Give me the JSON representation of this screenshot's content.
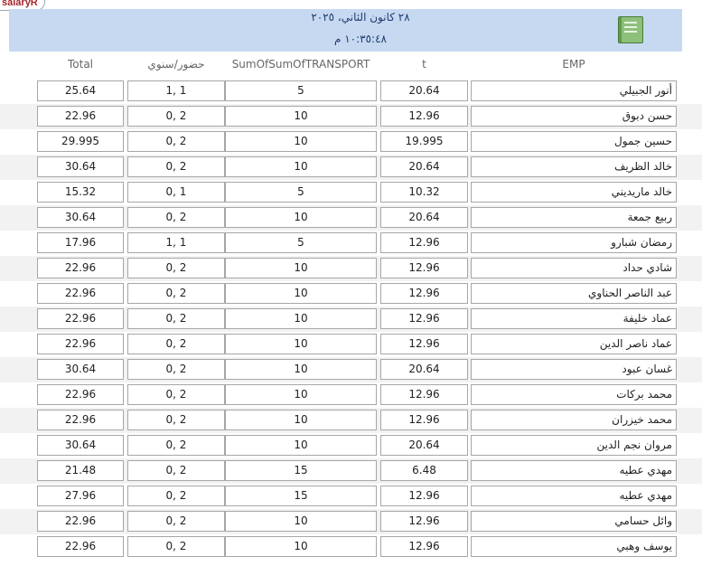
{
  "window": {
    "tab_label": "salaryR"
  },
  "header": {
    "date": "٢٨ كانون الثاني، ٢٠٢٥",
    "time": "١٠:٣٥:٤٨ م",
    "logo_icon": "report-logo-icon"
  },
  "columns": {
    "total": "Total",
    "attendance": "حضور/سنوي",
    "transport": "SumOfSumOfTRANSPORT",
    "t": "t",
    "emp": "EMP"
  },
  "rows": [
    {
      "total": "25.64",
      "attendance": "1, 1",
      "transport": "5",
      "t": "20.64",
      "emp": "أنور الجبيلي"
    },
    {
      "total": "22.96",
      "attendance": "0, 2",
      "transport": "10",
      "t": "12.96",
      "emp": "حسن دبوق"
    },
    {
      "total": "29.995",
      "attendance": "0, 2",
      "transport": "10",
      "t": "19.995",
      "emp": "حسين جمول"
    },
    {
      "total": "30.64",
      "attendance": "0, 2",
      "transport": "10",
      "t": "20.64",
      "emp": "خالد الظريف"
    },
    {
      "total": "15.32",
      "attendance": "0, 1",
      "transport": "5",
      "t": "10.32",
      "emp": "خالد ماريديني"
    },
    {
      "total": "30.64",
      "attendance": "0, 2",
      "transport": "10",
      "t": "20.64",
      "emp": "ربيع جمعة"
    },
    {
      "total": "17.96",
      "attendance": "1, 1",
      "transport": "5",
      "t": "12.96",
      "emp": "رمضان شبارو"
    },
    {
      "total": "22.96",
      "attendance": "0, 2",
      "transport": "10",
      "t": "12.96",
      "emp": "شادي حداد"
    },
    {
      "total": "22.96",
      "attendance": "0, 2",
      "transport": "10",
      "t": "12.96",
      "emp": "عبد الناصر الحناوي"
    },
    {
      "total": "22.96",
      "attendance": "0, 2",
      "transport": "10",
      "t": "12.96",
      "emp": "عماد خليفة"
    },
    {
      "total": "22.96",
      "attendance": "0, 2",
      "transport": "10",
      "t": "12.96",
      "emp": "عماد ناصر الدين"
    },
    {
      "total": "30.64",
      "attendance": "0, 2",
      "transport": "10",
      "t": "20.64",
      "emp": "غسان عبود"
    },
    {
      "total": "22.96",
      "attendance": "0, 2",
      "transport": "10",
      "t": "12.96",
      "emp": "محمد بركات"
    },
    {
      "total": "22.96",
      "attendance": "0, 2",
      "transport": "10",
      "t": "12.96",
      "emp": "محمد خيزران"
    },
    {
      "total": "30.64",
      "attendance": "0, 2",
      "transport": "10",
      "t": "20.64",
      "emp": "مروان نجم الدين"
    },
    {
      "total": "21.48",
      "attendance": "0, 2",
      "transport": "15",
      "t": "6.48",
      "emp": "مهدي عطيه"
    },
    {
      "total": "27.96",
      "attendance": "0, 2",
      "transport": "15",
      "t": "12.96",
      "emp": "مهدي عطيه"
    },
    {
      "total": "22.96",
      "attendance": "0, 2",
      "transport": "10",
      "t": "12.96",
      "emp": "وائل حسامي"
    },
    {
      "total": "22.96",
      "attendance": "0, 2",
      "transport": "10",
      "t": "12.96",
      "emp": "يوسف وهبي"
    }
  ]
}
